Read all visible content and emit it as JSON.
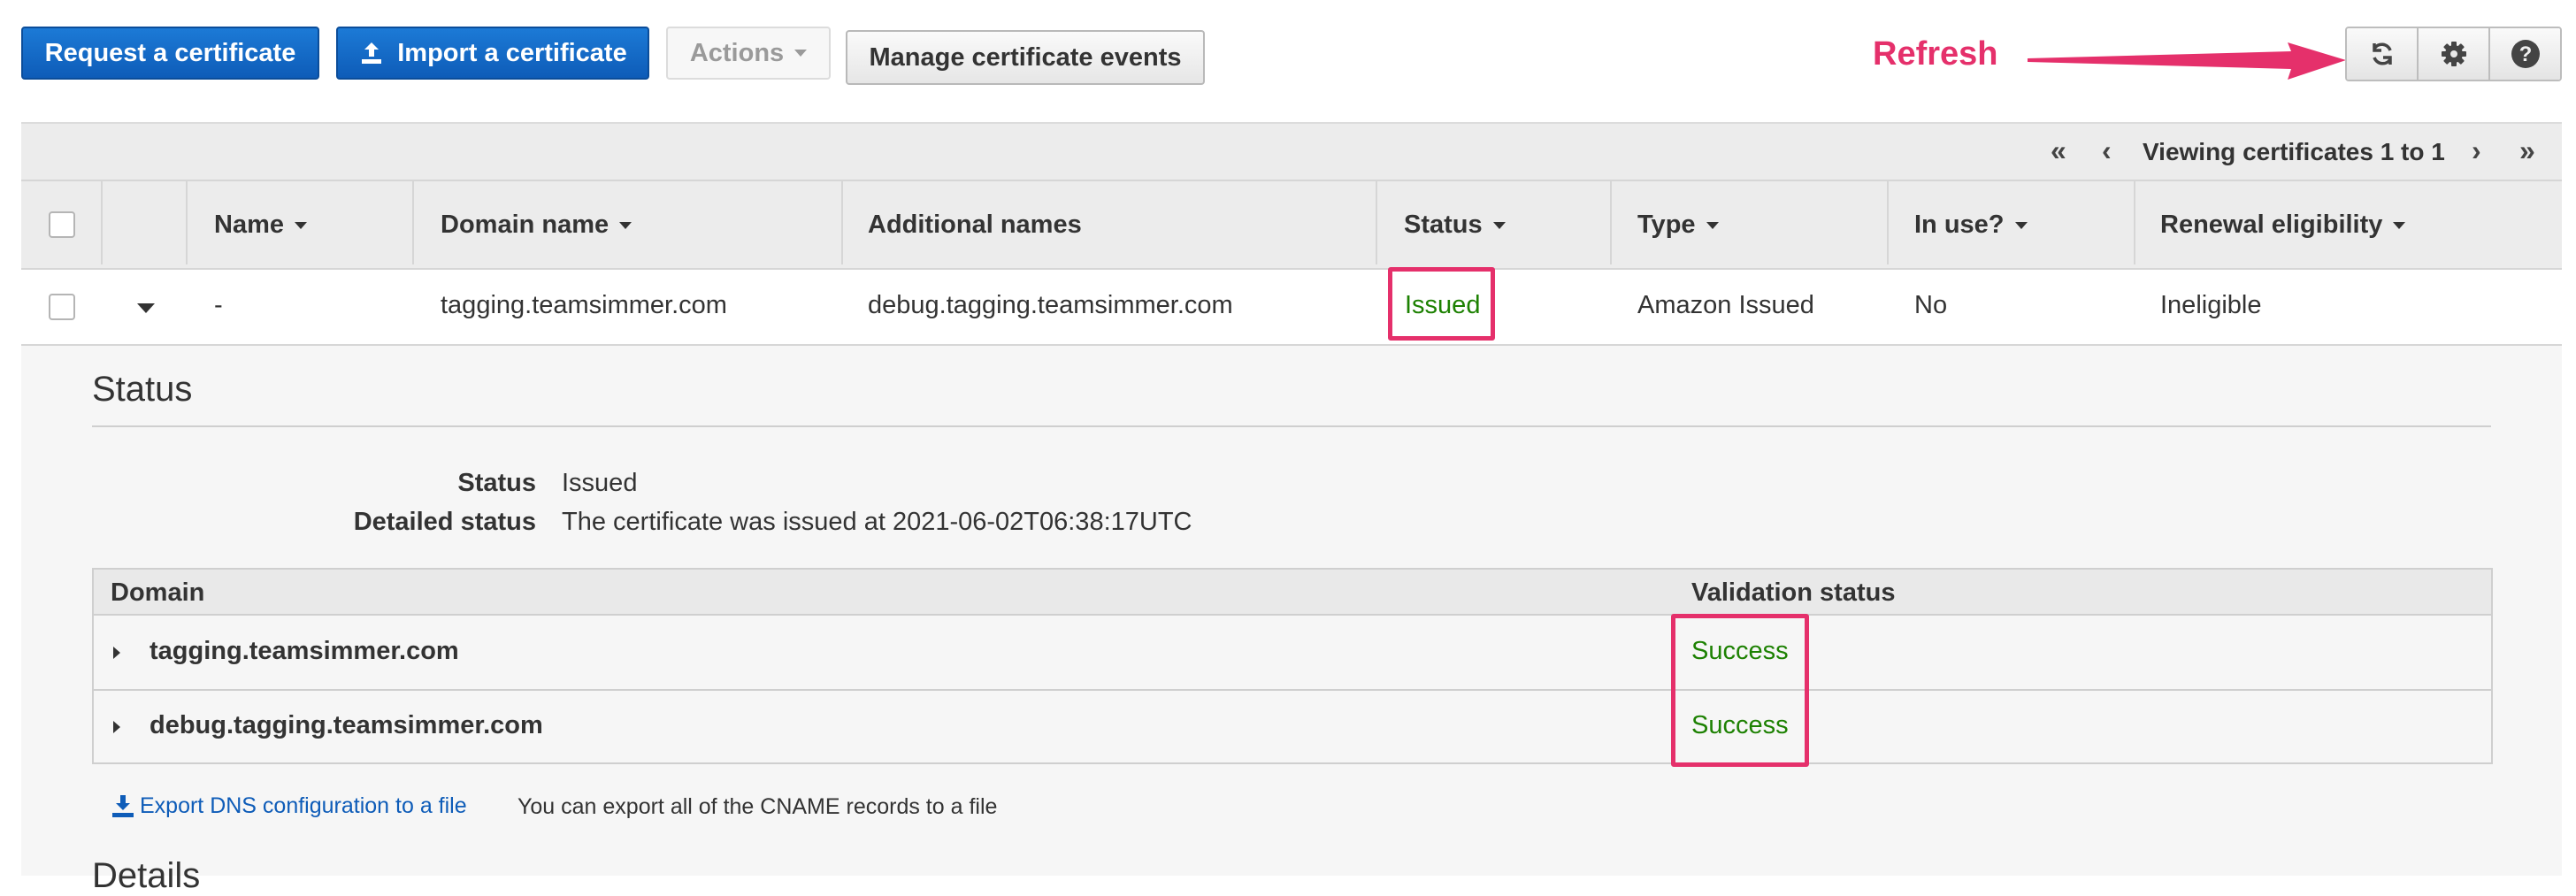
{
  "toolbar": {
    "request_label": "Request a certificate",
    "import_label": "Import a certificate",
    "actions_label": "Actions",
    "manage_events_label": "Manage certificate events"
  },
  "annotation": {
    "label": "Refresh",
    "color": "#e5306b"
  },
  "icons": {
    "refresh": "refresh-icon",
    "settings": "gear-icon",
    "help": "help-icon"
  },
  "pager": {
    "text": "Viewing certificates 1 to 1"
  },
  "grid": {
    "columns": [
      {
        "label": "Name",
        "sortable": true
      },
      {
        "label": "Domain name",
        "sortable": true
      },
      {
        "label": "Additional names",
        "sortable": false
      },
      {
        "label": "Status",
        "sortable": true
      },
      {
        "label": "Type",
        "sortable": true
      },
      {
        "label": "In use?",
        "sortable": true
      },
      {
        "label": "Renewal eligibility",
        "sortable": true
      }
    ],
    "rows": [
      {
        "name": "-",
        "domain": "tagging.teamsimmer.com",
        "additional": "debug.tagging.teamsimmer.com",
        "status": "Issued",
        "type": "Amazon Issued",
        "in_use": "No",
        "renewal": "Ineligible"
      }
    ]
  },
  "detail": {
    "section_title": "Status",
    "status_label": "Status",
    "status_value": "Issued",
    "detailed_label": "Detailed status",
    "detailed_value": "The certificate was issued at 2021-06-02T06:38:17UTC",
    "table": {
      "col_domain": "Domain",
      "col_validation": "Validation status",
      "rows": [
        {
          "domain": "tagging.teamsimmer.com",
          "validation": "Success"
        },
        {
          "domain": "debug.tagging.teamsimmer.com",
          "validation": "Success"
        }
      ]
    },
    "export_link": "Export DNS configuration to a file",
    "export_note": "You can export all of the CNAME records to a file",
    "next_section_title": "Details"
  },
  "colors": {
    "primary": "#0e5cb8",
    "success": "#1d8102",
    "highlight": "#e5306b"
  }
}
